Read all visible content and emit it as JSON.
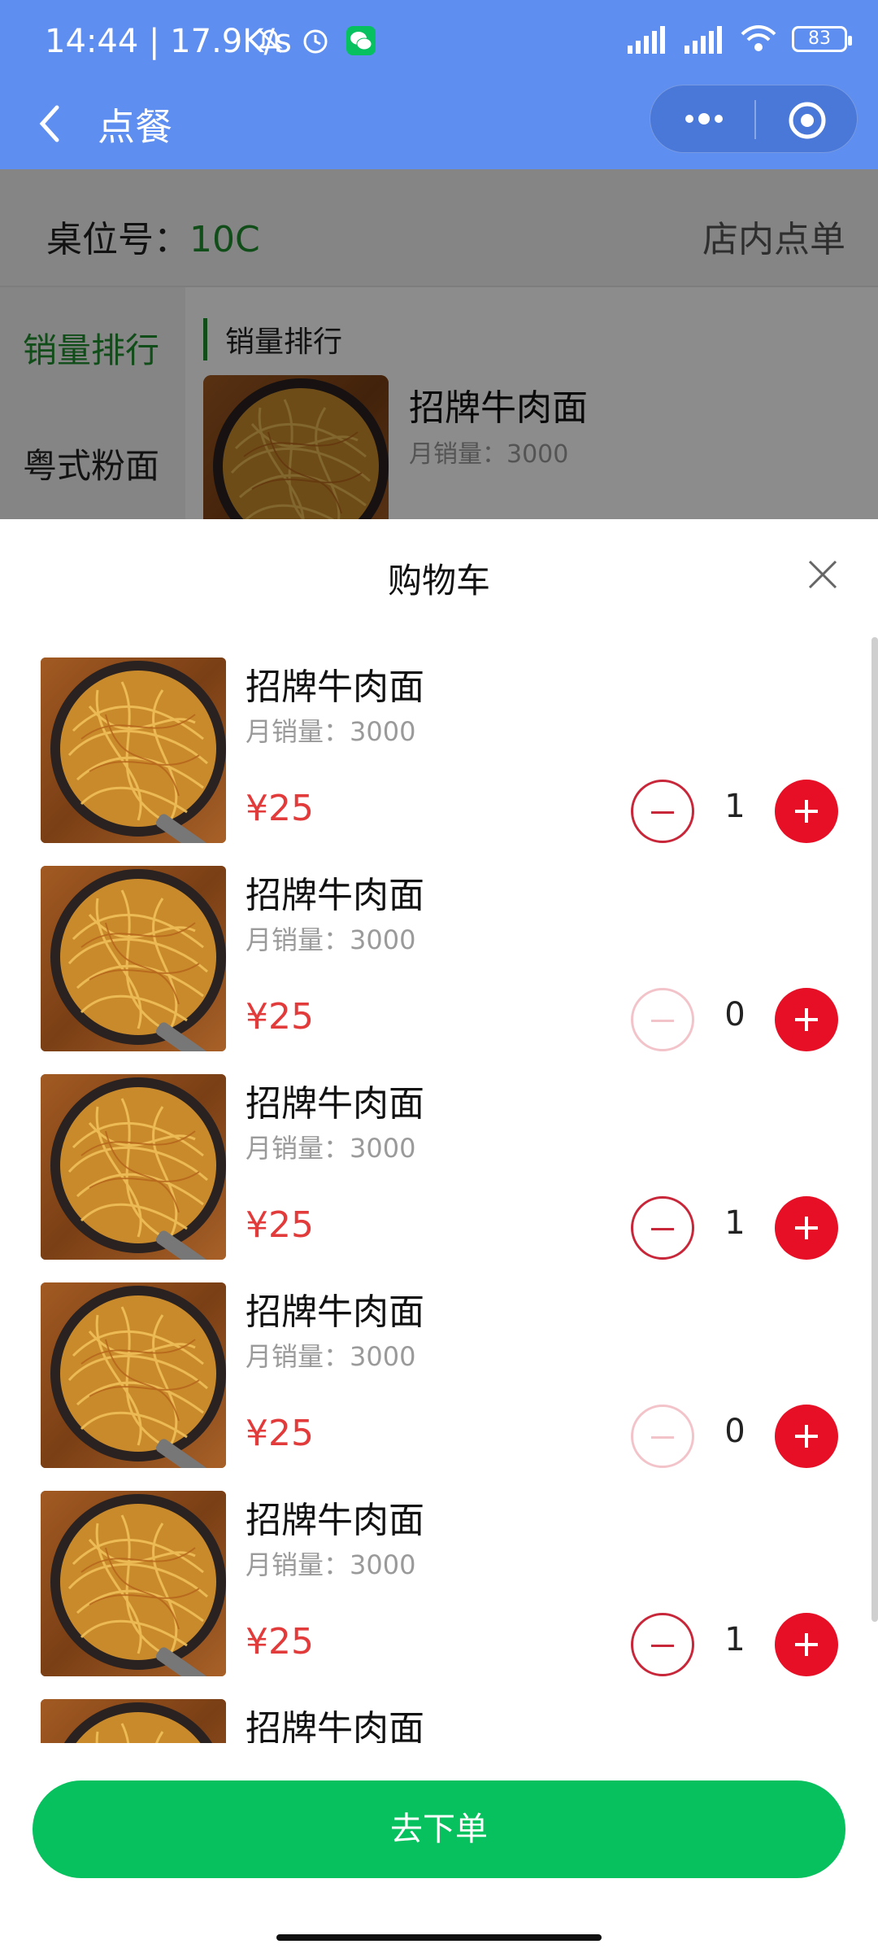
{
  "status_bar": {
    "time": "14:44 | 17.9K/s",
    "battery": "83"
  },
  "nav": {
    "title": "点餐"
  },
  "table_bar": {
    "label": "桌位号：",
    "table_number": "10C",
    "mode": "店内点单"
  },
  "sidebar": {
    "items": [
      {
        "label": "销量排行",
        "active": true
      },
      {
        "label": "粤式粉面",
        "active": false
      }
    ]
  },
  "menu": {
    "section_title": "销量排行",
    "first_item": {
      "name": "招牌牛肉面",
      "sales": "月销量：3000"
    }
  },
  "cart": {
    "title": "购物车",
    "items": [
      {
        "name": "招牌牛肉面",
        "sales": "月销量：3000",
        "price": "¥25",
        "qty": "1"
      },
      {
        "name": "招牌牛肉面",
        "sales": "月销量：3000",
        "price": "¥25",
        "qty": "0"
      },
      {
        "name": "招牌牛肉面",
        "sales": "月销量：3000",
        "price": "¥25",
        "qty": "1"
      },
      {
        "name": "招牌牛肉面",
        "sales": "月销量：3000",
        "price": "¥25",
        "qty": "0"
      },
      {
        "name": "招牌牛肉面",
        "sales": "月销量：3000",
        "price": "¥25",
        "qty": "1"
      },
      {
        "name": "招牌牛肉面",
        "sales": "",
        "price": "",
        "qty": ""
      }
    ]
  },
  "checkout": {
    "label": "去下单"
  },
  "colors": {
    "nav_blue": "#5e8ef0",
    "accent_green": "#1f8d2f",
    "price_red": "#e23b3b",
    "plus_red": "#e60f25",
    "order_green": "#06c15d"
  },
  "icons": [
    "back-arrow-icon",
    "more-dots-icon",
    "close-miniprogram-icon",
    "close-icon",
    "minus-icon",
    "plus-icon",
    "wifi-icon",
    "signal-icon",
    "alarm-icon",
    "wechat-icon",
    "mute-icon",
    "noodle-photo"
  ]
}
